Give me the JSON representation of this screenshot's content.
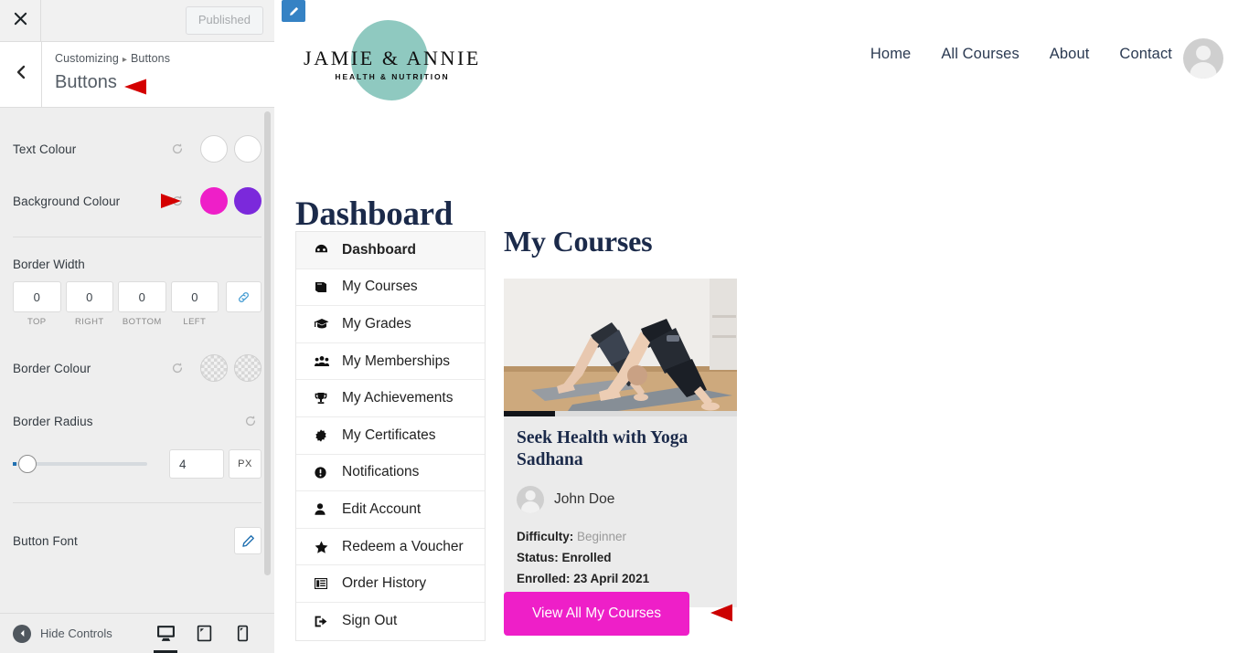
{
  "customizer": {
    "close_icon": "close-icon",
    "publish_label": "Published",
    "back_icon": "chevron-left-icon",
    "breadcrumb_root": "Customizing",
    "breadcrumb_sep": "▸",
    "breadcrumb_current": "Buttons",
    "panel_title": "Buttons",
    "controls": {
      "text_colour": {
        "label": "Text Colour",
        "reset_icon": "reset-icon",
        "swatch_1": "#ffffff",
        "swatch_2": "#ffffff"
      },
      "background_colour": {
        "label": "Background Colour",
        "reset_icon": "reset-icon",
        "swatch_1": "#ee1fc8",
        "swatch_2": "#7b29db"
      },
      "border_width": {
        "label": "Border Width",
        "values": [
          "0",
          "0",
          "0",
          "0"
        ],
        "captions": [
          "TOP",
          "RIGHT",
          "BOTTOM",
          "LEFT"
        ],
        "link_icon": "link-icon"
      },
      "border_colour": {
        "label": "Border Colour",
        "reset_icon": "reset-icon",
        "swatch_1": "transparent",
        "swatch_2": "transparent"
      },
      "border_radius": {
        "label": "Border Radius",
        "reset_icon": "reset-icon",
        "value": "4",
        "unit": "PX"
      },
      "button_font": {
        "label": "Button Font",
        "edit_icon": "pencil-icon"
      }
    },
    "footer": {
      "hide_controls_label": "Hide Controls",
      "collapse_icon": "collapse-left-icon",
      "devices": [
        {
          "name": "desktop-view-button",
          "icon": "desktop-icon",
          "active": true
        },
        {
          "name": "tablet-view-button",
          "icon": "tablet-icon",
          "active": false
        },
        {
          "name": "mobile-view-button",
          "icon": "mobile-icon",
          "active": false
        }
      ]
    }
  },
  "preview": {
    "edit_shortcut_icon": "pencil-icon",
    "brand": {
      "name": "JAMIE & ANNIE",
      "tagline": "HEALTH & NUTRITION",
      "circle_color": "#8fc9c0"
    },
    "nav": [
      {
        "label": "Home"
      },
      {
        "label": "All Courses"
      },
      {
        "label": "About"
      },
      {
        "label": "Contact"
      }
    ],
    "avatar": "user-avatar",
    "page_title": "Dashboard",
    "dashboard_nav": [
      {
        "label": "Dashboard",
        "icon": "speedometer-icon",
        "glyph": "☸",
        "active": true
      },
      {
        "label": "My Courses",
        "icon": "book-icon",
        "glyph": "📕",
        "active": false
      },
      {
        "label": "My Grades",
        "icon": "graduation-cap-icon",
        "glyph": "🎓",
        "active": false
      },
      {
        "label": "My Memberships",
        "icon": "users-icon",
        "glyph": "👥",
        "active": false
      },
      {
        "label": "My Achievements",
        "icon": "trophy-icon",
        "glyph": "🏆",
        "active": false
      },
      {
        "label": "My Certificates",
        "icon": "certificate-icon",
        "glyph": "✹",
        "active": false
      },
      {
        "label": "Notifications",
        "icon": "exclamation-circle-icon",
        "glyph": "❗",
        "active": false
      },
      {
        "label": "Edit Account",
        "icon": "user-icon",
        "glyph": "👤",
        "active": false
      },
      {
        "label": "Redeem a Voucher",
        "icon": "star-icon",
        "glyph": "★",
        "active": false
      },
      {
        "label": "Order History",
        "icon": "list-icon",
        "glyph": "▤",
        "active": false
      },
      {
        "label": "Sign Out",
        "icon": "sign-out-icon",
        "glyph": "→",
        "active": false
      }
    ],
    "courses_heading": "My Courses",
    "course_card": {
      "thumb_alt": "two-people-doing-downward-dog-yoga-pose",
      "progress_percent": 22,
      "title": "Seek Health with Yoga Sadhana",
      "author": "John Doe",
      "difficulty_label": "Difficulty:",
      "difficulty_value": "Beginner",
      "status_label": "Status:",
      "status_value": "Enrolled",
      "enrolled_label": "Enrolled:",
      "enrolled_value": "23 April 2021"
    },
    "view_all_label": "View All My Courses",
    "button_color": "#ee1fc8"
  },
  "annotations": {
    "arrow_color": "#e00000",
    "arrow_to_panel_title": "points-at-buttons-panel-title",
    "arrow_to_background_colour": "points-at-background-colour-reset",
    "arrow_to_view_all_button": "points-at-view-all-my-courses-button"
  }
}
